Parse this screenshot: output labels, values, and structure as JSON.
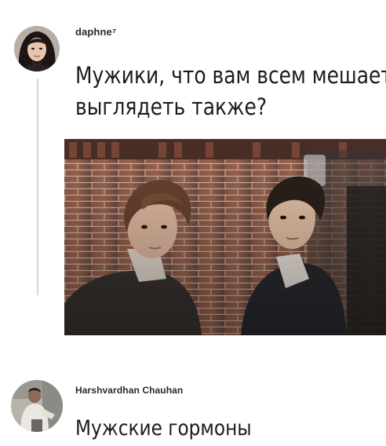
{
  "posts": [
    {
      "username": "daphne⁷",
      "avatar_icon": "profile-photo-icon",
      "text_lines": [
        "Мужики, что вам всем мешает",
        "выглядеть также?"
      ],
      "has_photo": true
    },
    {
      "username": "Harshvardhan Chauhan",
      "avatar_icon": "profile-photo-icon",
      "text": "Мужские гормоны"
    }
  ],
  "colors": {
    "background": "#ffffff",
    "text": "#1c1c1c",
    "thread_line": "#d6d6d6"
  }
}
